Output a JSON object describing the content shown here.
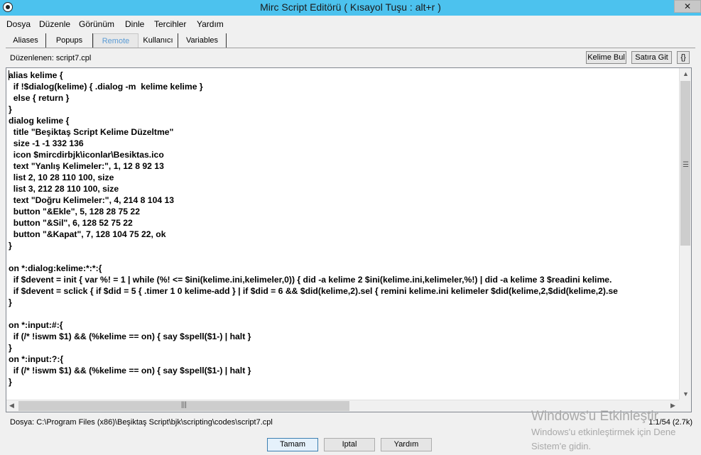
{
  "window": {
    "title": "Mirc Script Editörü ( Kısayol Tuşu : alt+r )",
    "close_label": "✕"
  },
  "menu": [
    "Dosya",
    "Düzenle",
    "Görünüm",
    "Dinle",
    "Tercihler",
    "Yardım"
  ],
  "tabs": [
    {
      "label": "Aliases",
      "active": false
    },
    {
      "label": "Popups",
      "active": false
    },
    {
      "label": "Remote",
      "active": true
    },
    {
      "label": "Kullanıcı",
      "active": false
    },
    {
      "label": "Variables",
      "active": false
    }
  ],
  "edited_file": "Düzenlenen: script7.cpl",
  "toolbar": {
    "find_word": "Kelime Bul",
    "goto_line": "Satıra Git",
    "braces": "{}"
  },
  "code_lines": [
    "alias kelime {",
    "  if !$dialog(kelime) { .dialog -m  kelime kelime }",
    "  else { return }",
    "}",
    "dialog kelime {",
    "  title \"Beşiktaş Script Kelime Düzeltme\"",
    "  size -1 -1 332 136",
    "  icon $mircdirbjk\\iconlar\\Besiktas.ico",
    "  text \"Yanlış Kelimeler:\", 1, 12 8 92 13",
    "  list 2, 10 28 110 100, size",
    "  list 3, 212 28 110 100, size",
    "  text \"Doğru Kelimeler:\", 4, 214 8 104 13",
    "  button \"&Ekle\", 5, 128 28 75 22",
    "  button \"&Sil\", 6, 128 52 75 22",
    "  button \"&Kapat\", 7, 128 104 75 22, ok",
    "}",
    "",
    "on *:dialog:kelime:*:*:{",
    "  if $devent = init { var %! = 1 | while (%! <= $ini(kelime.ini,kelimeler,0)) { did -a kelime 2 $ini(kelime.ini,kelimeler,%!) | did -a kelime 3 $readini kelime.",
    "  if $devent = sclick { if $did = 5 { .timer 1 0 kelime-add } | if $did = 6 && $did(kelime,2).sel { remini kelime.ini kelimeler $did(kelime,2,$did(kelime,2).se",
    "}",
    "",
    "on *:input:#:{",
    "  if (/* !iswm $1) && (%kelime == on) { say $spell($1-) | halt }",
    "}",
    "on *:input:?:{",
    "  if (/* !iswm $1) && (%kelime == on) { say $spell($1-) | halt }",
    "}"
  ],
  "status": {
    "path": "Dosya: C:\\Program Files (x86)\\Beşiktaş Script\\bjk\\scripting\\codes\\script7.cpl",
    "position": "1:1/54 (2.7k)"
  },
  "buttons": {
    "ok": "Tamam",
    "cancel": "Iptal",
    "help": "Yardım"
  },
  "watermark": {
    "title": "Windows'u Etkinleştir",
    "line1": "Windows'u etkinleştirmek için Dene",
    "line2": "Sistem'e gidin."
  }
}
